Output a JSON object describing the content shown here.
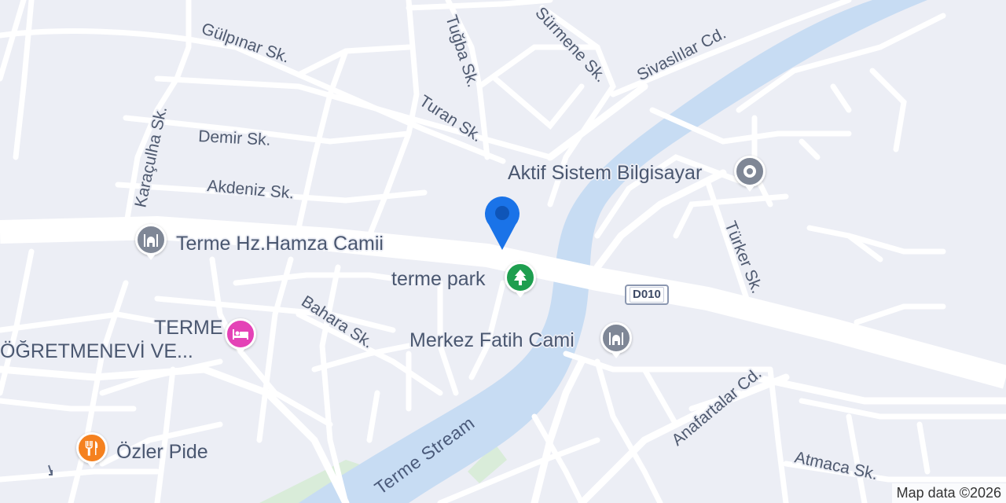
{
  "map": {
    "colors": {
      "land": "#eceef5",
      "road": "#ffffff",
      "water": "#c7dcf3",
      "park": "#d9ecd9",
      "text": "#4a5770",
      "location_pin": "#1a73e8",
      "mosque_pin": "#7f8796",
      "park_pin": "#1e9e4f",
      "hotel_pin": "#e442b6",
      "food_pin": "#f5811f",
      "poi_pin": "#7f8796"
    },
    "streets": {
      "gulpinar": "Gülpınar Sk.",
      "tugba": "Tuğba Sk.",
      "surmene": "Sürmene Sk.",
      "sivaslilar": "Sivaslılar Cd.",
      "karaculha": "Karaçulha Sk.",
      "demir": "Demir Sk.",
      "turan": "Turan Sk.",
      "akdeniz": "Akdeniz Sk.",
      "turker": "Türker Sk.",
      "bahara": "Bahara Sk.",
      "anafartalar": "Anafartalar Cd.",
      "atmaca": "Atmaca Sk."
    },
    "water": {
      "stream": "Terme Stream"
    },
    "road_shield": "D010",
    "places": {
      "aktif": "Aktif Sistem Bilgisayar",
      "hamza": "Terme Hz.Hamza Camii",
      "park": "terme park",
      "fatih": "Merkez Fatih Cami",
      "hotel_line1": "TERME",
      "hotel_line2": "ÖĞRETMENEVİ VE...",
      "pide": "Özler Pide"
    },
    "icons": {
      "location": "location-pin-icon",
      "mosque": "mosque-icon",
      "park": "tree-icon",
      "hotel": "bed-icon",
      "food": "fork-knife-icon",
      "poi": "generic-place-icon"
    },
    "attribution": "Map data ©2026"
  }
}
